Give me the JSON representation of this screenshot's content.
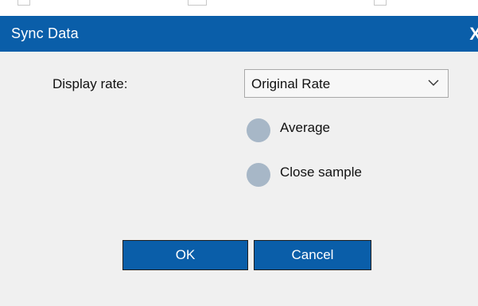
{
  "window": {
    "title": "Sync Data",
    "close_glyph": "X"
  },
  "form": {
    "display_rate_label": "Display rate:",
    "display_rate_selected": "Original Rate"
  },
  "radios": [
    {
      "label": "Average"
    },
    {
      "label": "Close sample"
    }
  ],
  "buttons": {
    "ok_label": "OK",
    "cancel_label": "Cancel"
  },
  "colors": {
    "title_bar": "#0a5ea9",
    "button": "#0a5ea9",
    "radio": "#a7b7c7",
    "background": "#f0f0f0"
  }
}
